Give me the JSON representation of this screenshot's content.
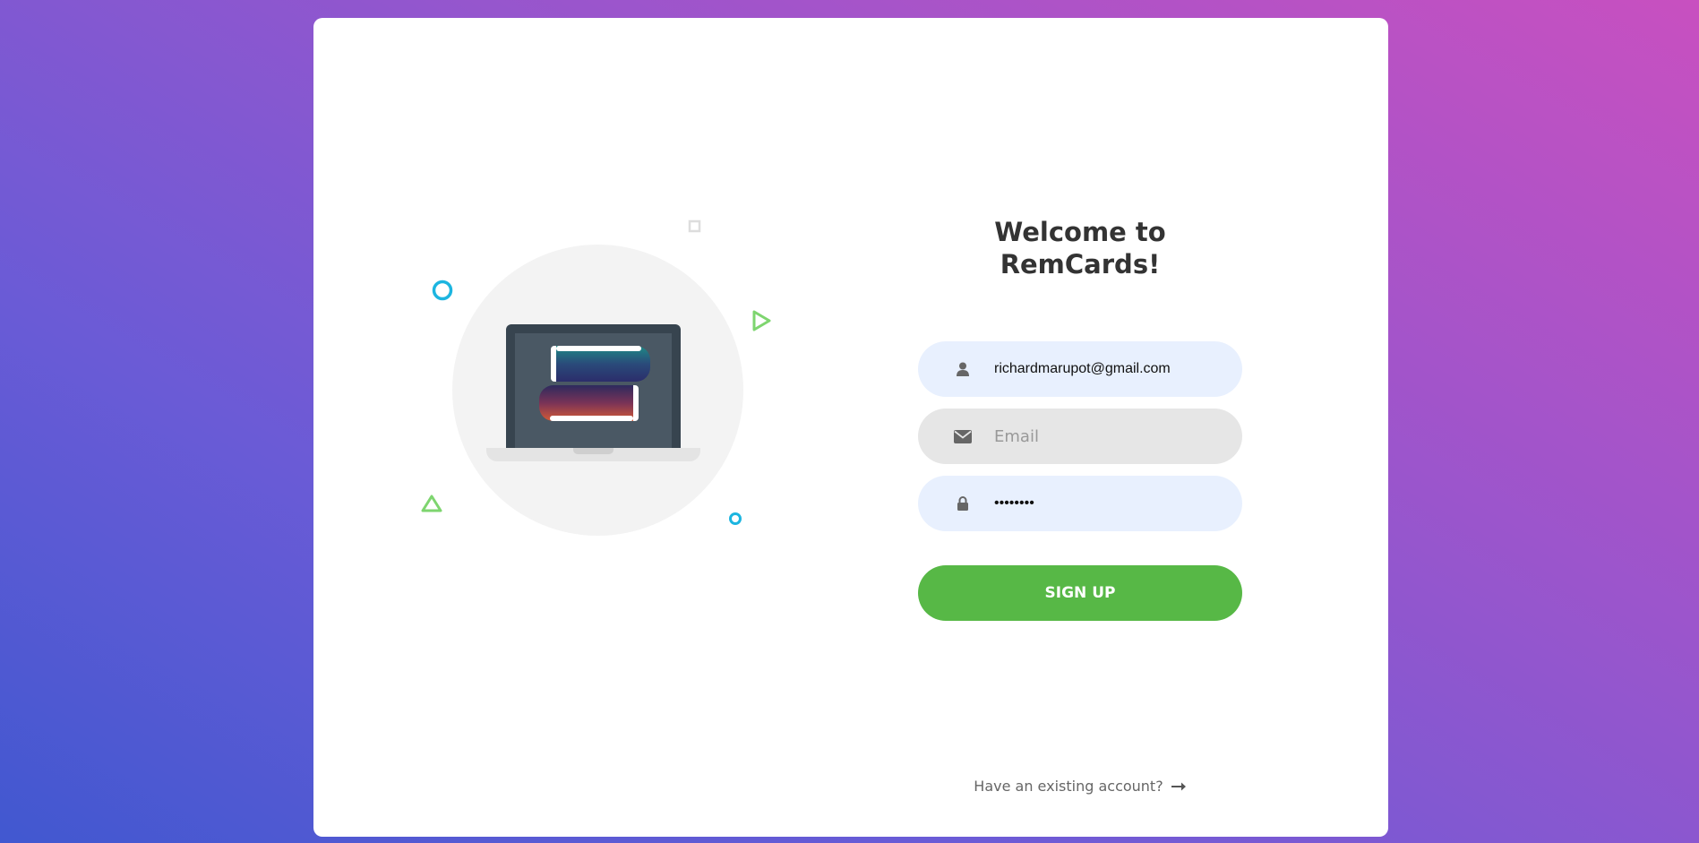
{
  "signup": {
    "title": "Welcome to RemCards!",
    "username_value": "richardmarupot@gmail.com",
    "email_placeholder": "Email",
    "password_value": "••••••••",
    "submit_label": "SIGN UP",
    "existing_account_link": "Have an existing account?"
  },
  "icons": {
    "username": "user-icon",
    "email": "envelope-icon",
    "password": "lock-icon",
    "link": "arrow-right-icon"
  },
  "colors": {
    "button": "#57b846",
    "field_background": "#e8f0fe",
    "field_background_empty": "#e6e6e6"
  }
}
